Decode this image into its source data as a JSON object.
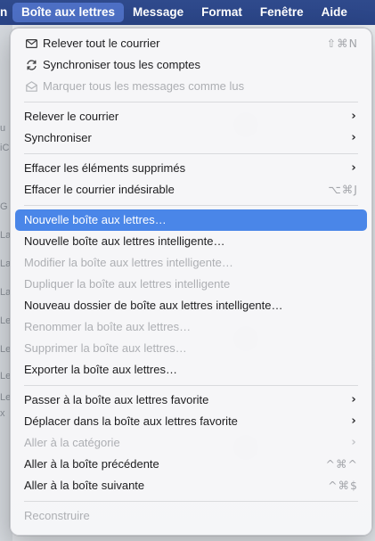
{
  "menubar": {
    "items": [
      {
        "label": "n"
      },
      {
        "label": "Boîte aux lettres"
      },
      {
        "label": "Message"
      },
      {
        "label": "Format"
      },
      {
        "label": "Fenêtre"
      },
      {
        "label": "Aide"
      }
    ]
  },
  "background": {
    "sidebar_letters": [
      "u",
      "iC",
      "G",
      "La",
      "La",
      "La",
      "Le",
      "Le",
      "Le",
      "Le",
      "x"
    ]
  },
  "menu": {
    "group1": [
      {
        "label": "Relever tout le courrier",
        "icon": "envelope-icon",
        "shortcut": "⇧⌘N"
      },
      {
        "label": "Synchroniser tous les comptes",
        "icon": "sync-icon",
        "shortcut": ""
      },
      {
        "label": "Marquer tous les messages comme lus",
        "icon": "envelope-open-icon",
        "shortcut": ""
      }
    ],
    "group2": [
      {
        "label": "Relever le courrier"
      },
      {
        "label": "Synchroniser"
      }
    ],
    "group3": [
      {
        "label": "Effacer les éléments supprimés"
      },
      {
        "label": "Effacer le courrier indésirable",
        "shortcut": "⌥⌘J"
      }
    ],
    "group4": [
      {
        "label": "Nouvelle boîte aux lettres…"
      },
      {
        "label": "Nouvelle boîte aux lettres intelligente…"
      },
      {
        "label": "Modifier la boîte aux lettres intelligente…"
      },
      {
        "label": "Dupliquer la boîte aux lettres intelligente"
      },
      {
        "label": "Nouveau dossier de boîte aux lettres intelligente…"
      },
      {
        "label": "Renommer la boîte aux lettres…"
      },
      {
        "label": "Supprimer la boîte aux lettres…"
      },
      {
        "label": "Exporter la boîte aux lettres…"
      }
    ],
    "group5": [
      {
        "label": "Passer à la boîte aux lettres favorite"
      },
      {
        "label": "Déplacer dans la boîte aux lettres favorite"
      },
      {
        "label": "Aller à la catégorie"
      },
      {
        "label": "Aller à la boîte précédente",
        "shortcut": "^⌘^"
      },
      {
        "label": "Aller à la boîte suivante",
        "shortcut": "^⌘$"
      }
    ],
    "group6": [
      {
        "label": "Reconstruire"
      }
    ],
    "chevron": "›"
  },
  "colors": {
    "menubar_bg": "#2a4486",
    "menubar_active": "#4d6fc4",
    "selection": "#4a86e8",
    "disabled_text": "#adafb3"
  }
}
